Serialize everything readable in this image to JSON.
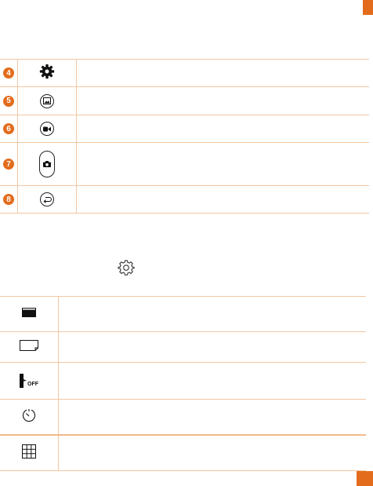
{
  "page": {
    "accent_color": "#e36c1c",
    "rule_color": "#f2c7a2"
  },
  "upper_table": {
    "rows": [
      {
        "number": "4",
        "icon": "settings-gear-icon"
      },
      {
        "number": "5",
        "icon": "gallery-icon"
      },
      {
        "number": "6",
        "icon": "video-record-icon"
      },
      {
        "number": "7",
        "icon": "camera-shutter-icon"
      },
      {
        "number": "8",
        "icon": "back-icon"
      }
    ]
  },
  "settings_icon": "settings-outline-gear-icon",
  "lower_table": {
    "rows": [
      {
        "icon": "image-size-icon"
      },
      {
        "icon": "photo-ratio-icon"
      },
      {
        "icon": "voice-shutter-off-icon",
        "icon_text": "OFF"
      },
      {
        "icon": "timer-icon"
      },
      {
        "icon": "grid-icon"
      }
    ]
  }
}
